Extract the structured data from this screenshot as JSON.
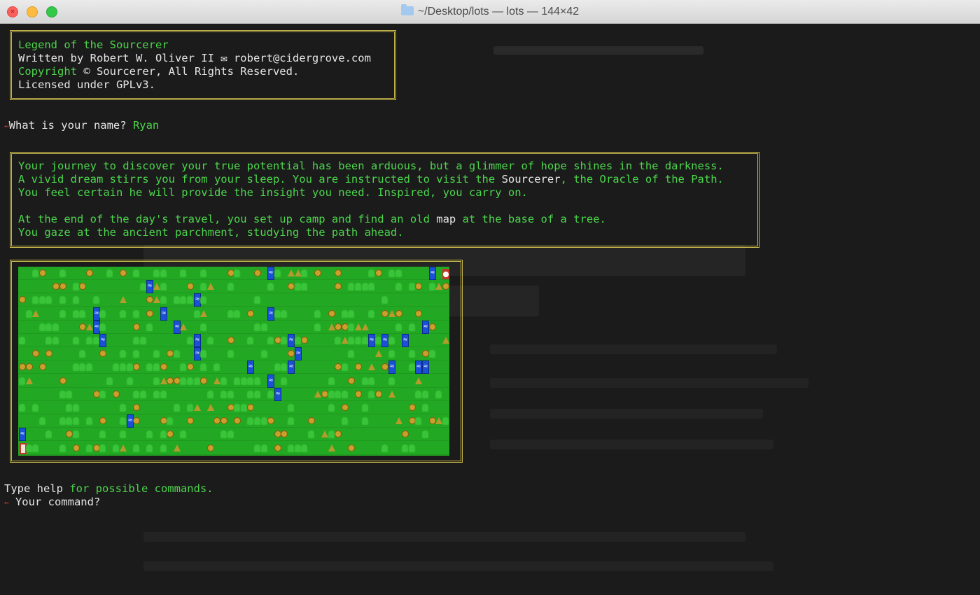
{
  "window": {
    "title": "~/Desktop/lots — lots — 144×42"
  },
  "header_box": {
    "game_title": "Legend of the Sourcerer",
    "author_line": "Written by Robert W. Oliver II ✉ robert@cidergrove.com",
    "copyright_word": "Copyright",
    "copyright_rest": " © Sourcerer, All Rights Reserved.",
    "license": "Licensed under GPLv3."
  },
  "name_prompt": {
    "arrow": "➻",
    "question": "What is your name? ",
    "answer": "Ryan"
  },
  "story_box": {
    "line1": "Your journey to discover your true potential has been arduous, but a glimmer of hope shines in the darkness.",
    "line2_a": "A vivid dream stirrs you from your sleep. You are instructed to visit the ",
    "line2_b": "Sourcerer",
    "line2_c": ", the Oracle of the Path.",
    "line3": "You feel certain he will provide the insight you need. Inspired, you carry on.",
    "line4_a": "At the end of the day's travel, you set up camp and find an old ",
    "line4_b": "map",
    "line4_c": " at the base of a tree.",
    "line5": "You gaze at the ancient parchment, studying the path ahead."
  },
  "help_line": {
    "type_word": "Type help",
    "rest": " for possible commands."
  },
  "command_prompt": {
    "arrow": "➻",
    "text": " Your command?"
  },
  "map": {
    "grass_color": "#22a822",
    "tree_color": "#39c43a",
    "water_color": "#1a4fd6",
    "villager_color": "#c9a02a",
    "mountain_color": "#b59a2c",
    "player_color": "#c0392b"
  }
}
